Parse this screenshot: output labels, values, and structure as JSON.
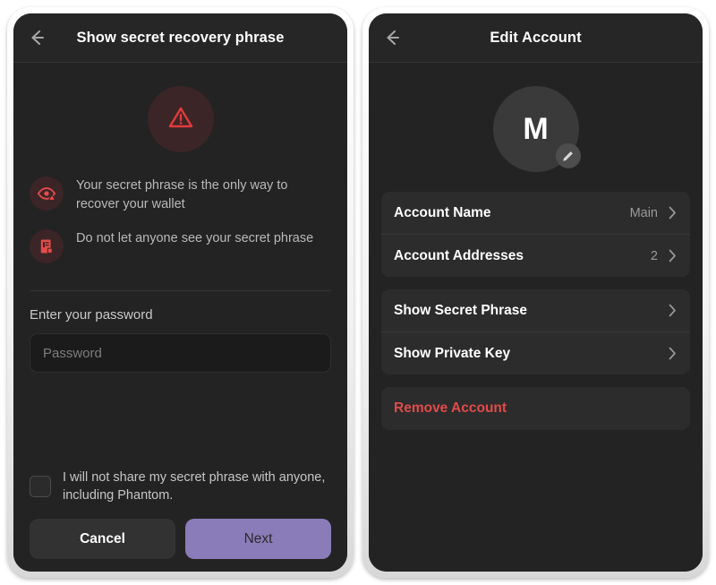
{
  "colors": {
    "screen_bg": "#232323",
    "header_bg": "#262626",
    "card_bg": "#2c2c2c",
    "accent_purple": "#8a7cb8",
    "danger_red": "#e14a4a",
    "warn_badge_bg": "#3c2527"
  },
  "left_screen": {
    "header": {
      "back_icon": "back-arrow-icon",
      "title": "Show secret recovery phrase"
    },
    "warning_icon": "warning-triangle-icon",
    "info_items": [
      {
        "icon": "eye-warning-icon",
        "text": "Your secret phrase is the only way to recover your wallet"
      },
      {
        "icon": "document-key-icon",
        "text": "Do not let anyone see your secret phrase"
      }
    ],
    "password": {
      "label": "Enter your password",
      "value": "",
      "placeholder": "Password"
    },
    "consent": {
      "checked": false,
      "label": "I will not share my secret phrase with anyone, including Phantom."
    },
    "buttons": {
      "cancel": "Cancel",
      "next": "Next"
    }
  },
  "right_screen": {
    "header": {
      "back_icon": "back-arrow-icon",
      "title": "Edit Account"
    },
    "avatar": {
      "initial": "M",
      "edit_icon": "pencil-icon"
    },
    "settings_group_1": [
      {
        "label": "Account Name",
        "value": "Main",
        "chevron": "chevron-right-icon"
      },
      {
        "label": "Account Addresses",
        "value": "2",
        "chevron": "chevron-right-icon"
      }
    ],
    "settings_group_2": [
      {
        "label": "Show Secret Phrase",
        "value": "",
        "chevron": "chevron-right-icon"
      },
      {
        "label": "Show Private Key",
        "value": "",
        "chevron": "chevron-right-icon"
      }
    ],
    "danger": {
      "label": "Remove Account"
    }
  }
}
